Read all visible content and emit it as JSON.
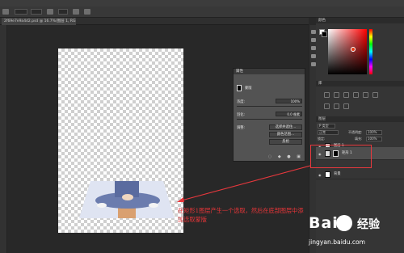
{
  "document": {
    "tab_title": "2f69e7e9a4d2.psd @ 16.7%(图层 1, RGB/8)"
  },
  "options_bar": {
    "labels": [
      "模式",
      "100%",
      "Fill"
    ]
  },
  "properties_panel": {
    "title": "属性",
    "section_label": "蒙版",
    "density_label": "浓度:",
    "density_value": "100%",
    "feather_label": "羽化:",
    "feather_value": "0.0 像素",
    "adjust_label": "调整:",
    "select_mask_button": "选择并遮住...",
    "color_range_button": "颜色范围...",
    "invert_button": "反相"
  },
  "right_dock": {
    "color_panel_title": "颜色",
    "libraries_title": "库",
    "layers_title": "图层",
    "kind_filter": "P 类型",
    "blend_mode": "正常",
    "opacity_label": "不透明度:",
    "opacity_value": "100%",
    "lock_label": "锁定:",
    "fill_label": "填充:",
    "fill_value": "100%",
    "layers": [
      {
        "name": "图层 1",
        "selected": false,
        "has_mask": false
      },
      {
        "name": "矩形 1",
        "selected": true,
        "has_mask": true
      },
      {
        "name": "背景",
        "selected": false,
        "has_mask": false
      }
    ]
  },
  "annotation": {
    "text": "在矩形1图层产生一个选取，然后在底部图层中添加选取蒙版",
    "color": "#e83538"
  },
  "watermark": {
    "brand": "Bai",
    "brand_cn": "经验",
    "url": "jingyan.baidu.com"
  },
  "colors": {
    "app_bg": "#282828",
    "panel_bg": "#535353",
    "accent_red": "#e8383d"
  }
}
